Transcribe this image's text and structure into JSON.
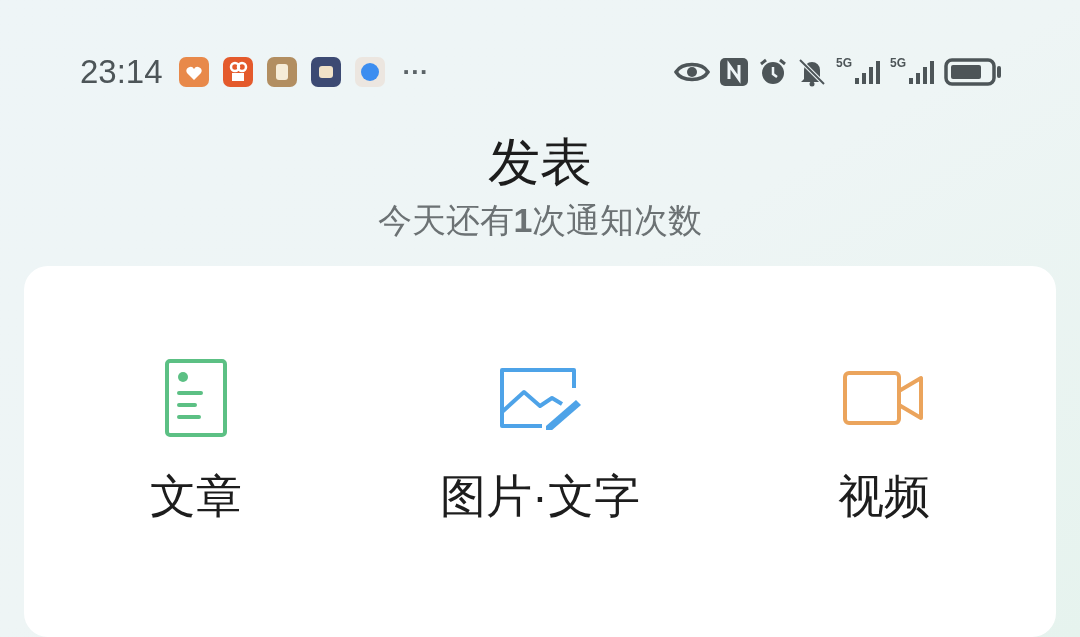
{
  "status_bar": {
    "time": "23:14",
    "more": "···",
    "network_labels": [
      "5G",
      "5G"
    ]
  },
  "header": {
    "title": "发表",
    "subtitle": "今天还有**1**次通知次数"
  },
  "options": [
    {
      "kind": "article",
      "label": "文章"
    },
    {
      "kind": "image",
      "label": "图片·文字"
    },
    {
      "kind": "video",
      "label": "视频"
    }
  ]
}
